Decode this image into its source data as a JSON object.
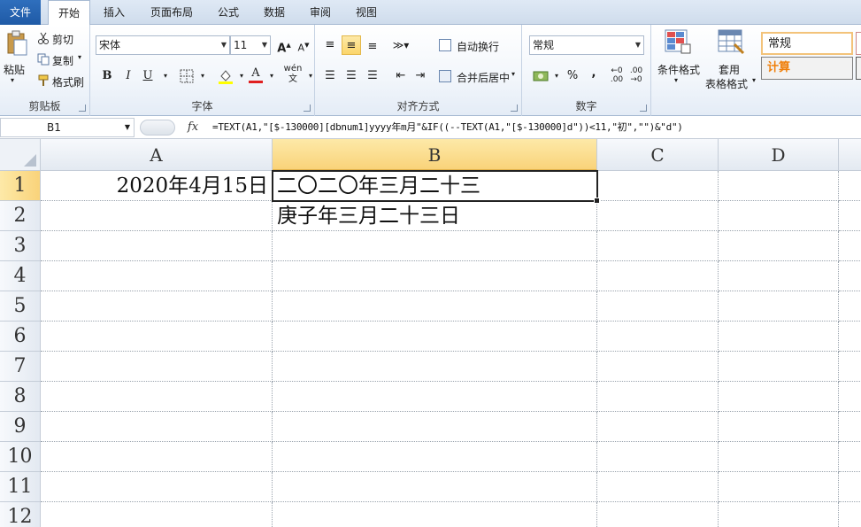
{
  "tabs": [
    "文件",
    "开始",
    "插入",
    "页面布局",
    "公式",
    "数据",
    "审阅",
    "视图"
  ],
  "active_tab": "开始",
  "ribbon": {
    "clipboard": {
      "paste": "粘贴",
      "cut": "剪切",
      "copy": "复制",
      "format_painter": "格式刷",
      "label": "剪贴板"
    },
    "font": {
      "name": "宋体",
      "size": "11",
      "bold": "B",
      "italic": "I",
      "underline": "U",
      "label": "字体"
    },
    "alignment": {
      "wrap": "自动换行",
      "merge": "合并后居中",
      "label": "对齐方式"
    },
    "number": {
      "format": "常规",
      "percent": "%",
      "comma": ",",
      "label": "数字"
    },
    "styles": {
      "conditional": "条件格式",
      "table_format_1": "套用",
      "table_format_2": "表格格式",
      "normal": "常规",
      "calc": "计算"
    }
  },
  "formula_bar": {
    "name_box": "B1",
    "fx": "fx",
    "formula": "=TEXT(A1,\"[$-130000][dbnum1]yyyy年m月\"&IF((--TEXT(A1,\"[$-130000]d\"))<11,\"初\",\"\")&\"d\")"
  },
  "columns": [
    "A",
    "B",
    "C",
    "D"
  ],
  "rows": [
    "1",
    "2",
    "3",
    "4",
    "5",
    "6",
    "7",
    "8",
    "9",
    "10",
    "11",
    "12"
  ],
  "cells": {
    "A1": "2020年4月15日",
    "B1": "二〇二〇年三月二十三",
    "B2": "庚子年三月二十三日"
  },
  "colors": {
    "selection_header": "#fbd66b",
    "file_tab": "#2a64b4",
    "calc_text": "#f07f09"
  }
}
